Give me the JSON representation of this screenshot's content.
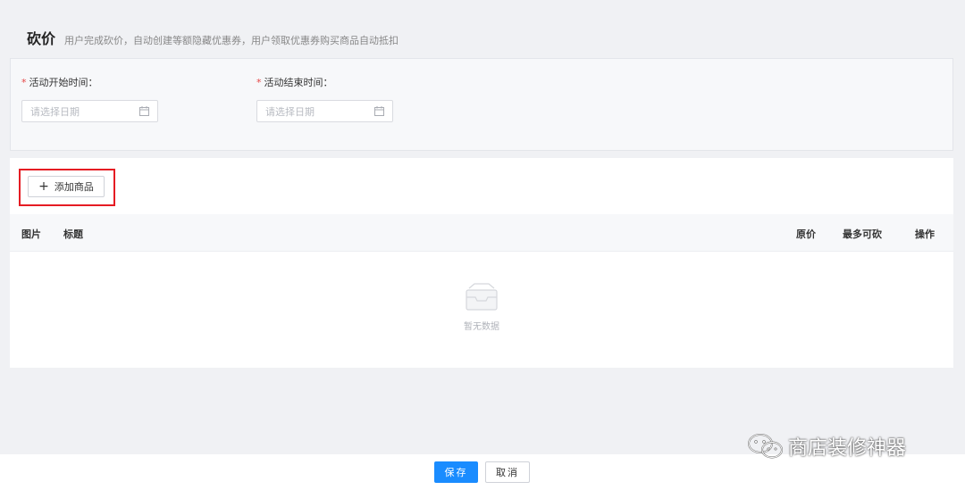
{
  "header": {
    "title": "砍价",
    "description": "用户完成砍价，自动创建等额隐藏优惠券，用户领取优惠券购买商品自动抵扣"
  },
  "date_fields": {
    "start": {
      "required_mark": "*",
      "label": "活动开始时间：",
      "placeholder": "请选择日期",
      "icon": "calendar-icon"
    },
    "end": {
      "required_mark": "*",
      "label": "活动结束时间：",
      "placeholder": "请选择日期",
      "icon": "calendar-icon"
    }
  },
  "goods": {
    "add_button": {
      "icon": "plus-icon",
      "icon_glyph": "+",
      "label": "添加商品"
    },
    "table_headers": {
      "image": "图片",
      "title": "标题",
      "original_price": "原价",
      "max_bargain": "最多可砍",
      "action": "操作"
    },
    "empty_text": "暂无数据",
    "empty_icon": "empty-inbox-icon"
  },
  "footer": {
    "save_label": "保存",
    "cancel_label": "取消"
  },
  "watermark": {
    "icon": "wechat-icon",
    "text": "商店装修神器"
  },
  "colors": {
    "primary": "#1a8cff",
    "required": "#e54545",
    "highlight": "#e51c23",
    "background": "#f0f1f4"
  }
}
